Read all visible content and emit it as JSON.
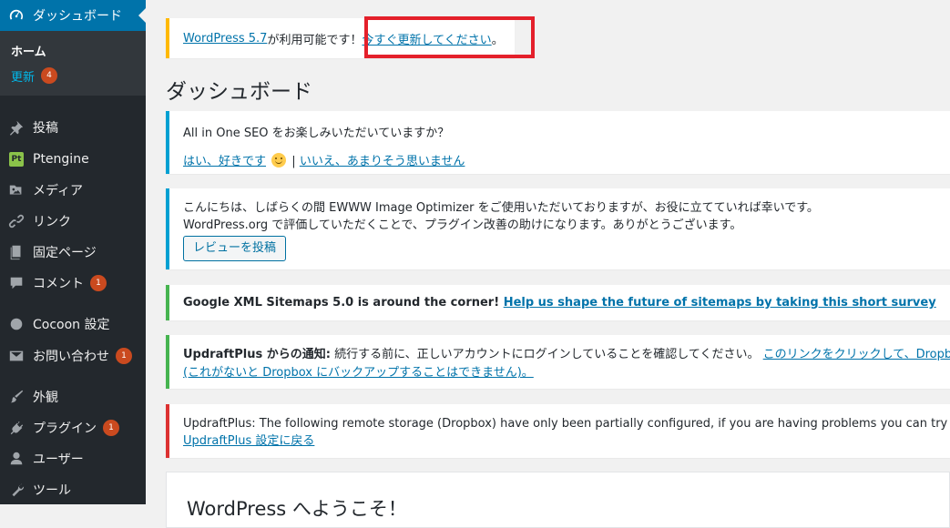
{
  "sidebar": {
    "dashboard": "ダッシュボード",
    "home": "ホーム",
    "updates": "更新",
    "updates_count": "4",
    "items": [
      {
        "label": "投稿",
        "icon": "pin-icon"
      },
      {
        "label": "Ptengine",
        "icon": "ptengine-icon",
        "icon_text": "Pt"
      },
      {
        "label": "メディア",
        "icon": "media-icon"
      },
      {
        "label": "リンク",
        "icon": "link-icon"
      },
      {
        "label": "固定ページ",
        "icon": "page-icon"
      },
      {
        "label": "コメント",
        "icon": "comment-icon",
        "badge": "1"
      },
      {
        "label": "Cocoon 設定",
        "icon": "circle-icon"
      },
      {
        "label": "お問い合わせ",
        "icon": "mail-icon",
        "badge": "1"
      },
      {
        "label": "外観",
        "icon": "brush-icon"
      },
      {
        "label": "プラグイン",
        "icon": "plugin-icon",
        "badge": "1"
      },
      {
        "label": "ユーザー",
        "icon": "user-icon"
      },
      {
        "label": "ツール",
        "icon": "wrench-icon"
      }
    ]
  },
  "update_nag": {
    "version_link": "WordPress 5.7",
    "text": " が利用可能です！",
    "update_link": "今すぐ更新してください",
    "end": "。"
  },
  "page_title": "ダッシュボード",
  "notices": {
    "aioseo": {
      "question": "All in One SEO をお楽しみいただいていますか？",
      "yes": "はい、好きです",
      "sep": " | ",
      "no": "いいえ、あまりそう思いません"
    },
    "ewww": {
      "line1": "こんにちは、しばらくの間 EWWW Image Optimizer をご使用いただいておりますが、お役に立てていれば幸いです。",
      "line2": "WordPress.org で評価していただくことで、プラグイン改善の助けになります。ありがとうございます。",
      "button": "レビューを投稿"
    },
    "sitemaps": {
      "text": "Google XML Sitemaps 5.0 is around the corner! ",
      "link": "Help us shape the future of sitemaps by taking this short survey"
    },
    "updraft_notice": {
      "title": "UpdraftPlus からの通知:",
      "text": " 続行する前に、正しいアカウントにログインしていることを確認してください。 ",
      "link1": "このリンクをクリックして、Dropbox",
      "link2": "(これがないと Dropbox にバックアップすることはできません)。"
    },
    "updraft_error": {
      "text": "UpdraftPlus: The following remote storage (Dropbox) have only been partially configured, if you are having problems you can try to manually au",
      "link": "UpdraftPlus 設定に戻る"
    }
  },
  "welcome_title": "WordPress へようこそ！"
}
